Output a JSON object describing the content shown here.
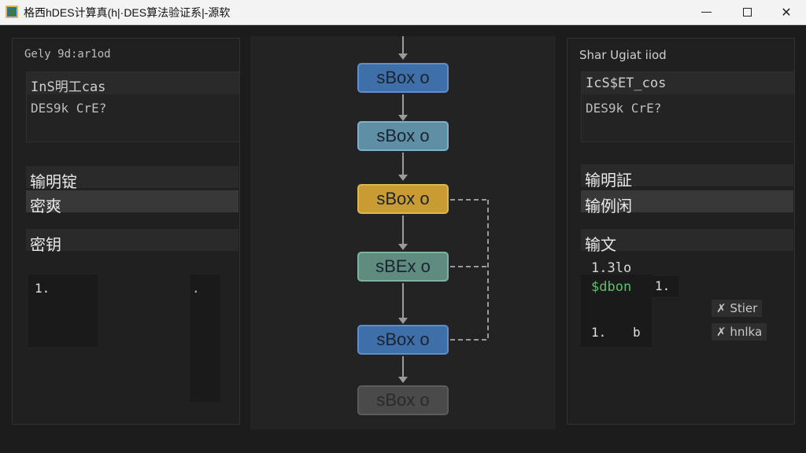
{
  "window": {
    "title": "格西hDES计算真(h|·DES算法验证系|-源软"
  },
  "left_panel": {
    "header": "Gely 9d:ar1od",
    "field1": "InS明工cas",
    "field2": "DES9k CrE?",
    "row_input": "输明锭",
    "row_key_alt": "密爽",
    "row_key": "密钥",
    "list_item_1": "1.",
    "list_item_2": "."
  },
  "center": {
    "boxes": [
      {
        "label": "sBox o",
        "color": "#3f6fa8"
      },
      {
        "label": "sBox o",
        "color": "#5f8fa5"
      },
      {
        "label": "sBox o",
        "color": "#c89b33"
      },
      {
        "label": "sBEx o",
        "color": "#5f8c7f"
      },
      {
        "label": "sBox o",
        "color": "#3f6fa8"
      },
      {
        "label": "sBox o",
        "color": "#4a4a4a"
      }
    ]
  },
  "right_panel": {
    "header": "Shar Ugiat iiod",
    "field1": "IcS$ET_cos",
    "field2": "DES9k CrE?",
    "row_output": "输明証",
    "row_output2": "输例闲",
    "row_cipher": "输文",
    "log_line1": "1.3lo",
    "log_line2": "$dbon",
    "log_line2b": "1.",
    "log_line3a": "1.",
    "log_line3b": "b",
    "chip1": "✗ Stier",
    "chip2": "✗ hnlka"
  }
}
